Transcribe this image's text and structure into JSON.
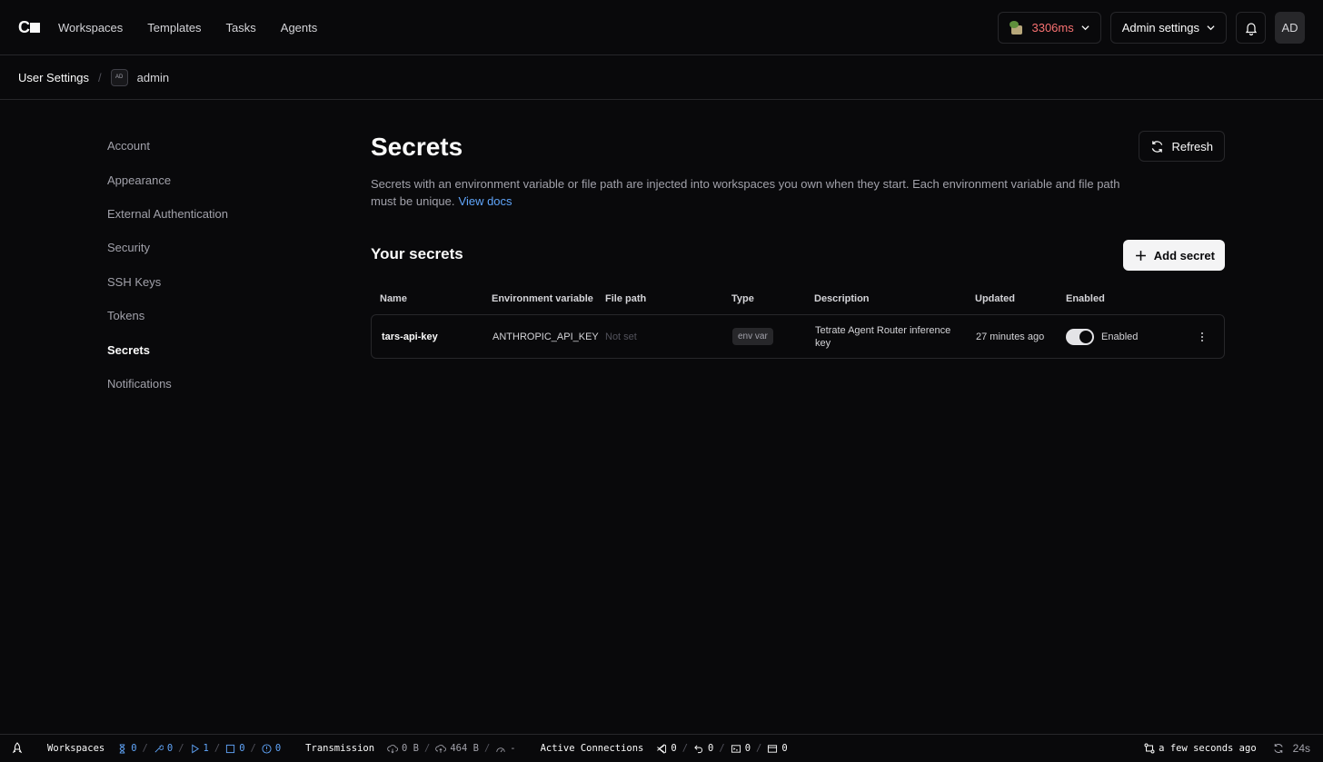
{
  "nav": {
    "links": [
      "Workspaces",
      "Templates",
      "Tasks",
      "Agents"
    ],
    "latency": "3306ms",
    "admin_settings": "Admin settings",
    "avatar": "AD"
  },
  "breadcrumb": {
    "root": "User Settings",
    "sep": "/",
    "avatar": "AD",
    "user": "admin"
  },
  "sidebar": {
    "items": [
      "Account",
      "Appearance",
      "External Authentication",
      "Security",
      "SSH Keys",
      "Tokens",
      "Secrets",
      "Notifications"
    ],
    "active": "Secrets"
  },
  "main": {
    "title": "Secrets",
    "description": "Secrets with an environment variable or file path are injected into workspaces you own when they start. Each environment variable and file path must be unique.",
    "docs_link": "View docs",
    "refresh_label": "Refresh",
    "section_title": "Your secrets",
    "add_label": "Add secret"
  },
  "table": {
    "headers": [
      "Name",
      "Environment variable",
      "File path",
      "Type",
      "Description",
      "Updated",
      "Enabled"
    ],
    "rows": [
      {
        "name": "tars-api-key",
        "env": "ANTHROPIC_API_KEY",
        "path": "Not set",
        "type": "env var",
        "description": "Tetrate Agent Router inference key",
        "updated": "27 minutes ago",
        "enabled_label": "Enabled"
      }
    ]
  },
  "statusbar": {
    "workspaces_label": "Workspaces",
    "ws_pending": "0",
    "ws_building": "0",
    "ws_running": "1",
    "ws_stopped": "0",
    "ws_errored": "0",
    "transmission_label": "Transmission",
    "rx": "0 B",
    "tx": "464 B",
    "latency": "-",
    "connections_label": "Active Connections",
    "vscode": "0",
    "ssh": "0",
    "terminal": "0",
    "apps": "0",
    "updated": "a few seconds ago",
    "refresh": "24s"
  },
  "colors": {
    "background": "#09090b",
    "border": "#27272a",
    "link": "#60a5fa",
    "latency": "#f87171"
  }
}
